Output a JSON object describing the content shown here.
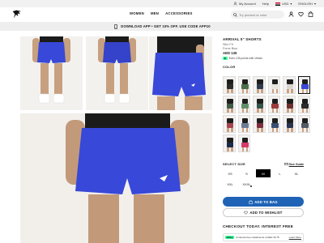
{
  "util": {
    "account": "My Account",
    "help": "Help",
    "currency": "USD",
    "language": "ENGLISH"
  },
  "header": {
    "logo_icon": "gymshark-logo-icon",
    "nav": [
      "WOMEN",
      "MEN",
      "ACCESSORIES"
    ],
    "search_placeholder": "Try product or color",
    "icons": [
      "user-icon",
      "heart-icon",
      "bag-icon"
    ]
  },
  "promo": {
    "icon": "phone-icon",
    "text": "DOWNLOAD APP • GET 10% OFF. USE CODE APP10"
  },
  "product": {
    "title": "ARRIVAL 5\" SHORTS",
    "fit": "Slim Fit",
    "color_name": "Force Blue",
    "price": "AED 135",
    "tabby_text": "Earn 135 points with Vedds"
  },
  "colors": {
    "label": "COLOR",
    "swatches": [
      {
        "color": "#2b2b2b"
      },
      {
        "color": "#4b6e4a"
      },
      {
        "color": "#2f3b4c"
      },
      {
        "color": "#e7e4de"
      },
      {
        "color": "#d8d5cf"
      },
      {
        "color": "#3848d8",
        "selected": true
      },
      {
        "color": "#3f5a48"
      },
      {
        "color": "#5f8f68"
      },
      {
        "color": "#35524a"
      },
      {
        "color": "#9b3b3b"
      },
      {
        "color": "#6b2f2f"
      },
      {
        "color": "#2a2a2a"
      },
      {
        "color": "#a5434f"
      },
      {
        "color": "#6b7d94"
      },
      {
        "color": "#7b2e3e"
      },
      {
        "color": "#3a4f72"
      },
      {
        "color": "#2a3350"
      },
      {
        "color": "#515a66"
      },
      {
        "color": "#1a2a4a"
      },
      {
        "color": "#d63a68"
      }
    ]
  },
  "sizes": {
    "label": "SELECT SIZE",
    "guide": "Size Guide",
    "options": [
      {
        "label": "XS"
      },
      {
        "label": "S"
      },
      {
        "label": "M",
        "selected": true
      },
      {
        "label": "L"
      },
      {
        "label": "XL"
      },
      {
        "label": "XXL"
      },
      {
        "label": "XXXL",
        "low": true
      }
    ]
  },
  "actions": {
    "add_to_bag": "ADD TO BAG",
    "add_to_wishlist": "ADD TO WISHLIST"
  },
  "checkout": {
    "title": "CHECKOUT TODAY. INTEREST FREE",
    "tabby_badge": "tabby",
    "tabby_text": "4 interest-free installments of AED 33.75",
    "learn_more": "Learn More"
  },
  "colors_theme": {
    "primary_button": "#1e63b6",
    "short_color": "#3848d8"
  }
}
